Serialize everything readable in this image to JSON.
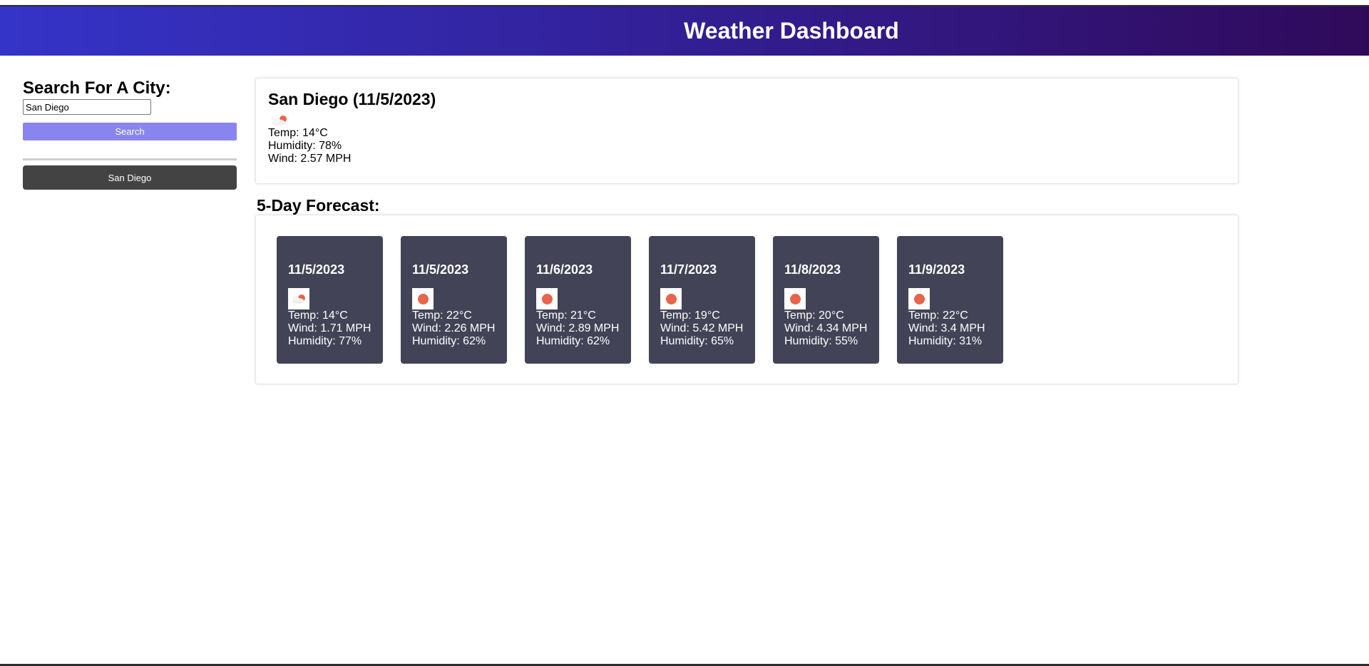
{
  "header": {
    "title": "Weather Dashboard"
  },
  "sidebar": {
    "heading": "Search For A City:",
    "search_value": "San Diego",
    "search_button": "Search",
    "history": [
      "San Diego"
    ]
  },
  "current": {
    "title": "San Diego (11/5/2023)",
    "icon": "partly-cloudy-icon",
    "temp": "Temp: 14°C",
    "humidity": "Humidity: 78%",
    "wind": "Wind: 2.57 MPH"
  },
  "forecast": {
    "title": "5-Day Forecast:",
    "days": [
      {
        "date": "11/5/2023",
        "icon": "partly-cloudy-icon",
        "temp": "Temp: 14°C",
        "wind": "Wind: 1.71 MPH",
        "humidity": "Humidity: 77%"
      },
      {
        "date": "11/5/2023",
        "icon": "sun-icon",
        "temp": "Temp: 22°C",
        "wind": "Wind: 2.26 MPH",
        "humidity": "Humidity: 62%"
      },
      {
        "date": "11/6/2023",
        "icon": "sun-icon",
        "temp": "Temp: 21°C",
        "wind": "Wind: 2.89 MPH",
        "humidity": "Humidity: 62%"
      },
      {
        "date": "11/7/2023",
        "icon": "sun-icon",
        "temp": "Temp: 19°C",
        "wind": "Wind: 5.42 MPH",
        "humidity": "Humidity: 65%"
      },
      {
        "date": "11/8/2023",
        "icon": "sun-icon",
        "temp": "Temp: 20°C",
        "wind": "Wind: 4.34 MPH",
        "humidity": "Humidity: 55%"
      },
      {
        "date": "11/9/2023",
        "icon": "sun-icon",
        "temp": "Temp: 22°C",
        "wind": "Wind: 3.4 MPH",
        "humidity": "Humidity: 31%"
      }
    ]
  },
  "colors": {
    "header_start": "#3434c8",
    "header_end": "#300a5a",
    "search_button": "#8a85ee",
    "history_button": "#434343",
    "card_bg": "#424356",
    "sun": "#e8644a"
  }
}
